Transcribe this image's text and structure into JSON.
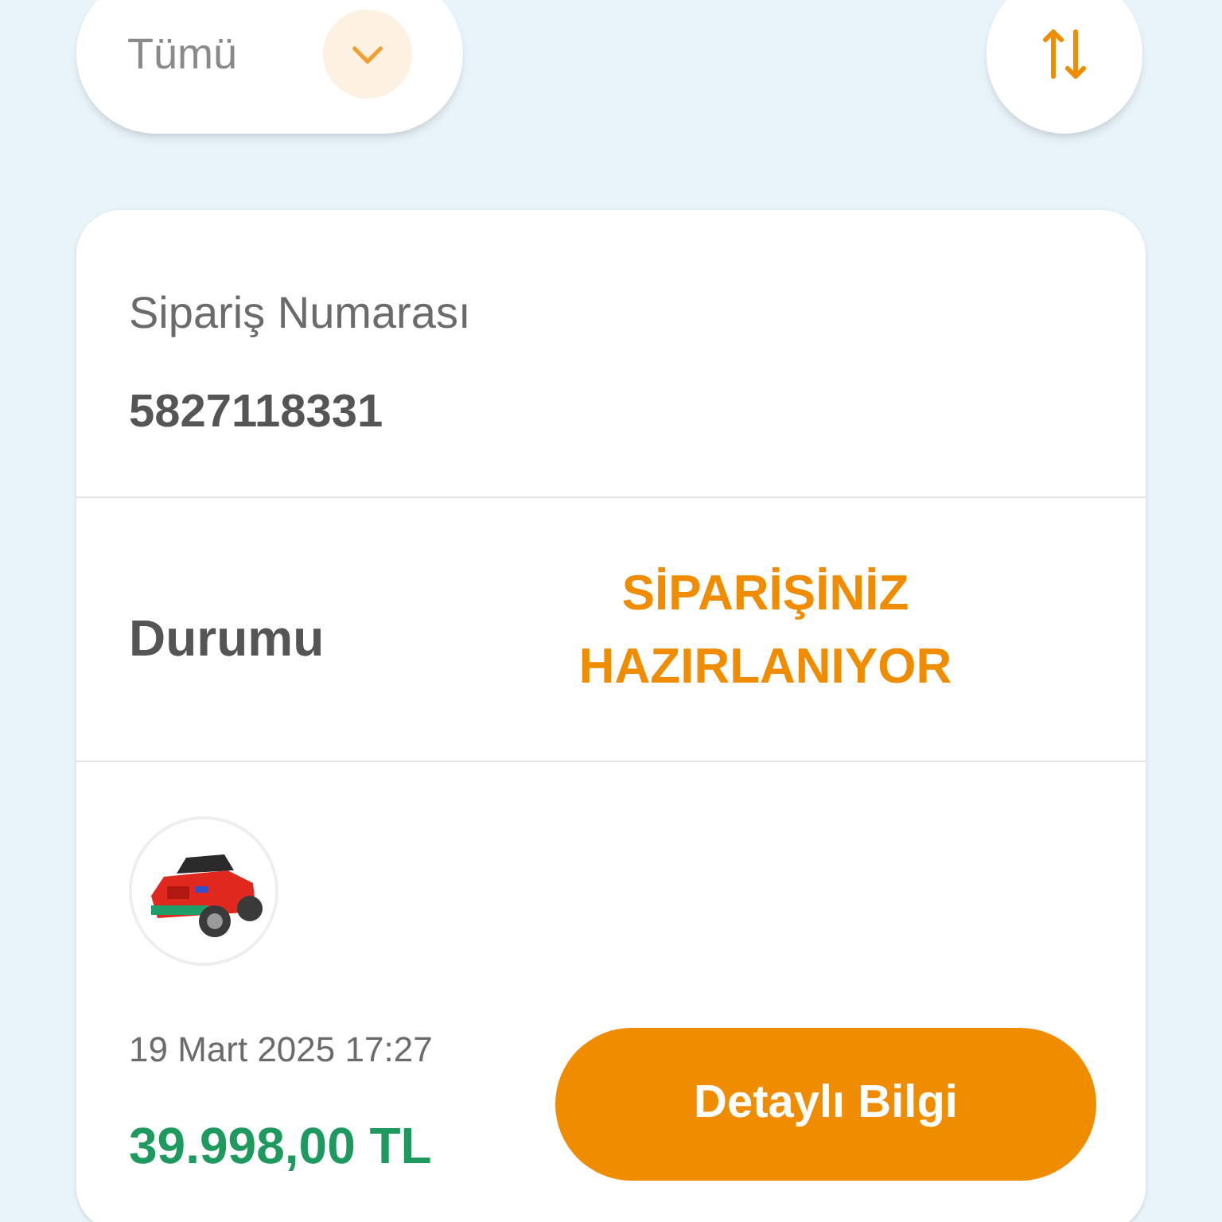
{
  "filter": {
    "label": "Tümü"
  },
  "order": {
    "number_label": "Sipariş Numarası",
    "number": "5827118331",
    "status_label": "Durumu",
    "status": "SİPARİŞİNİZ HAZIRLANIYOR",
    "date": "19 Mart 2025 17:27",
    "price": "39.998,00 TL",
    "details_button": "Detaylı Bilgi"
  }
}
